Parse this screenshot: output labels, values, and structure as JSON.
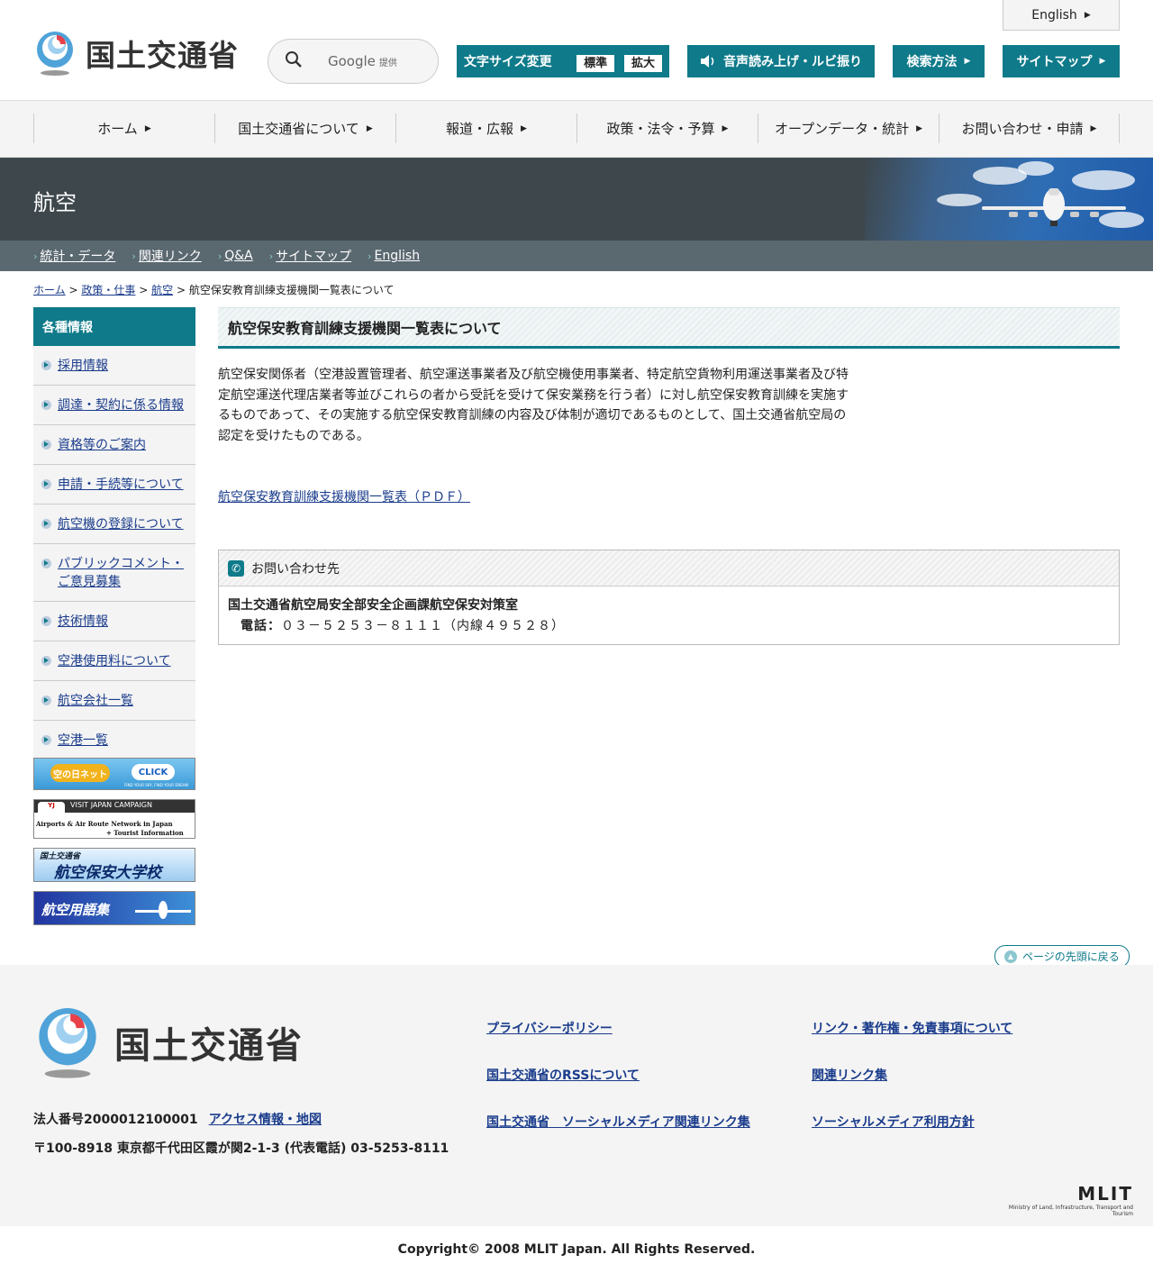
{
  "header": {
    "logo_text": "国土交通省",
    "search_provider": "Google",
    "search_provider_suffix": "提供",
    "english": "English",
    "font_size": {
      "label": "文字サイズ変更",
      "standard": "標準",
      "large": "拡大"
    },
    "voice": "音声読み上げ・ルビ振り",
    "search_method": "検索方法",
    "sitemap": "サイトマップ"
  },
  "gnav": {
    "items": [
      {
        "label": "ホーム"
      },
      {
        "label": "国土交通省について"
      },
      {
        "label": "報道・広報"
      },
      {
        "label": "政策・法令・予算"
      },
      {
        "label": "オープンデータ・統計"
      },
      {
        "label": "お問い合わせ・申請"
      }
    ]
  },
  "banner": {
    "title": "航空"
  },
  "subnav": {
    "items": [
      {
        "label": "統計・データ"
      },
      {
        "label": "関連リンク"
      },
      {
        "label": "Q&A"
      },
      {
        "label": "サイトマップ"
      },
      {
        "label": "English"
      }
    ]
  },
  "breadcrumb": {
    "home": "ホーム",
    "policy": "政策・仕事",
    "aviation": "航空",
    "current": "航空保安教育訓練支援機関一覧表について",
    "sep": ">"
  },
  "sidebar": {
    "title": "各種情報",
    "items": [
      {
        "label": "採用情報"
      },
      {
        "label": "調達・契約に係る情報"
      },
      {
        "label": "資格等のご案内"
      },
      {
        "label": "申請・手続等について"
      },
      {
        "label": "航空機の登録について"
      },
      {
        "label": "パブリックコメント・ご意見募集"
      },
      {
        "label": "技術情報"
      },
      {
        "label": "空港使用料について"
      },
      {
        "label": "航空会社一覧"
      },
      {
        "label": "空港一覧"
      }
    ],
    "banners": {
      "b1_text": "空の日ネット",
      "b1_click": "CLICK",
      "b1_sub": "FIND YOUR SKY, FIND YOUR DREAM",
      "b2_top": "VISIT JAPAN CAMPAIGN",
      "b2_main": "Airports & Air Route Network in Japan",
      "b2_sub": "+ Tourist Information",
      "b3_small": "国土交通省",
      "b3_main": "航空保安大学校",
      "b4_main": "航空用語集"
    }
  },
  "main": {
    "title": "航空保安教育訓練支援機関一覧表について",
    "body": "航空保安関係者（空港設置管理者、航空運送事業者及び航空機使用事業者、特定航空貨物利用運送事業者及び特定航空運送代理店業者等並びこれらの者から受託を受けて保安業務を行う者）に対し航空保安教育訓練を実施するものであって、その実施する航空保安教育訓練の内容及び体制が適切であるものとして、国土交通省航空局の認定を受けたものである。",
    "pdf_link": "航空保安教育訓練支援機関一覧表（ＰＤＦ）",
    "contact": {
      "heading": "お問い合わせ先",
      "org": "国土交通省航空局安全部安全企画課航空保安対策室",
      "tel_label": "電話：",
      "tel": "０３－５２５３－８１１１（内線４９５２８）"
    }
  },
  "pagetop": "ページの先頭に戻る",
  "footer": {
    "logo_text": "国土交通省",
    "corp_no": "法人番号2000012100001",
    "access": "アクセス情報・地図",
    "address": "〒100-8918 東京都千代田区霞が関2-1-3 (代表電話) 03-5253-8111",
    "links_col1": [
      {
        "label": "プライバシーポリシー"
      },
      {
        "label": "国土交通省のRSSについて"
      },
      {
        "label": "国土交通省　ソーシャルメディア関連リンク集"
      }
    ],
    "links_col2": [
      {
        "label": "リンク・著作権・免責事項について"
      },
      {
        "label": "関連リンク集"
      },
      {
        "label": "ソーシャルメディア利用方針"
      }
    ],
    "mlit_logo": "MLIT",
    "mlit_sub": "Ministry of Land, Infrastructure, Transport and Tourism"
  },
  "copyright": "Copyright© 2008 MLIT Japan. All Rights Reserved.",
  "colors": {
    "accent": "#0e7a8a",
    "banner": "#3d474c",
    "subnav": "#5a6870"
  }
}
